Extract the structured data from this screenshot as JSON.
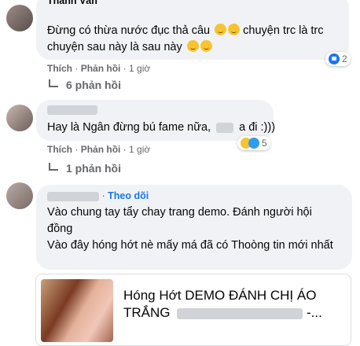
{
  "comments": [
    {
      "author": "Thanh Vân",
      "text_line1": "Đừng có thừa nước đục thả câu",
      "text_line1b": "chuyện trc là trc",
      "text_line2": "chuyện sau này là sau này",
      "actions": {
        "like": "Thích",
        "reply": "Phản hồi",
        "time": "1 giờ"
      },
      "reaction_count": "2",
      "replies_label": "6 phản hồi"
    },
    {
      "text_part1": "Hay là Ngân đừng bú fame nữa,",
      "text_part2": "a đi :)))",
      "actions": {
        "like": "Thích",
        "reply": "Phản hồi",
        "time": "1 giờ"
      },
      "reaction_count": "5",
      "replies_label": "1 phản hồi"
    },
    {
      "follow_label": "Theo dõi",
      "line1": "Vào chung tay tẩy chay trang demo. Đánh người hội",
      "line2": "đồng",
      "line3": "Vào đây hóng hớt nè mấy má đã có Thoòng tin mới nhất",
      "link_card": {
        "title_line1": "Hóng Hớt DEMO ĐÁNH CHỊ ÁO",
        "title_line2": "TRẮNG"
      }
    }
  ],
  "separator": "·",
  "ellipsis": "-..."
}
